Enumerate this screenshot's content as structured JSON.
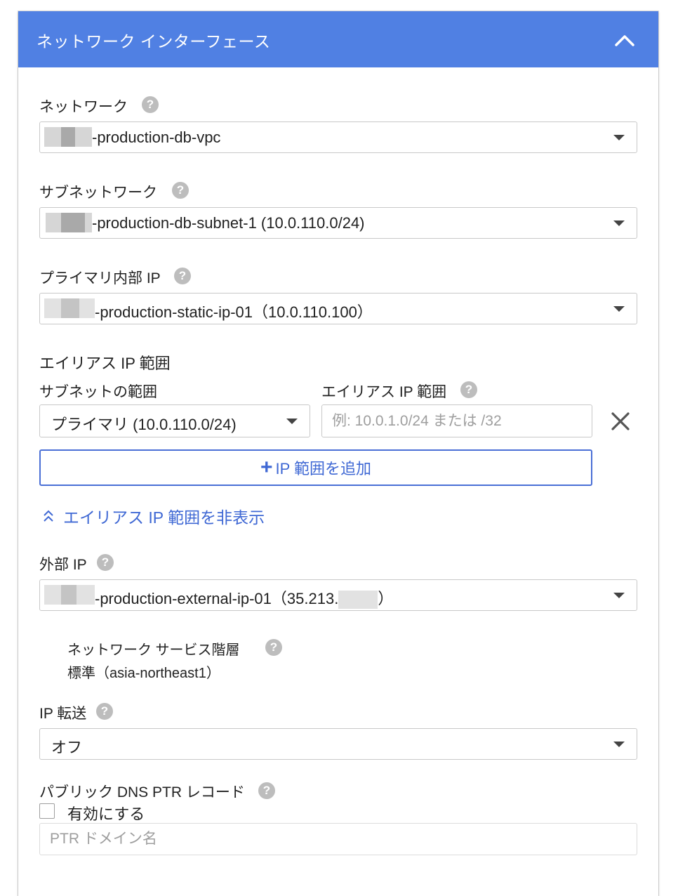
{
  "header": {
    "title": "ネットワーク インターフェース",
    "collapse_icon": "chevron-up-icon"
  },
  "network": {
    "label": "ネットワーク",
    "value": "-production-db-vpc"
  },
  "subnetwork": {
    "label": "サブネットワーク",
    "value": "-production-db-subnet-1 (10.0.110.0/24)"
  },
  "primary_ip": {
    "label": "プライマリ内部 IP",
    "value": "-production-static-ip-01（10.0.110.100）"
  },
  "alias": {
    "section_label": "エイリアス IP 範囲",
    "subnet_range_label": "サブネットの範囲",
    "alias_range_label": "エイリアス IP 範囲",
    "subnet_range_value": "プライマリ (10.0.110.0/24)",
    "alias_range_placeholder": "例: 10.0.1.0/24 または /32",
    "add_button_label": "IP 範囲を追加",
    "hide_link_label": "エイリアス IP 範囲を非表示"
  },
  "external_ip": {
    "label": "外部 IP",
    "value": "-production-external-ip-01（35.213.",
    "value_suffix": "）",
    "tier_label": "ネットワーク サービス階層",
    "tier_value": "標準（asia-northeast1）"
  },
  "ip_forwarding": {
    "label": "IP 転送",
    "value": "オフ"
  },
  "dns_ptr": {
    "label": "パブリック DNS PTR レコード",
    "checkbox_label": "有効にする",
    "placeholder": "PTR ドメイン名"
  },
  "colors": {
    "header_bg": "#5080e3",
    "accent": "#3f68d4",
    "help_icon": "#bdbdbd"
  }
}
